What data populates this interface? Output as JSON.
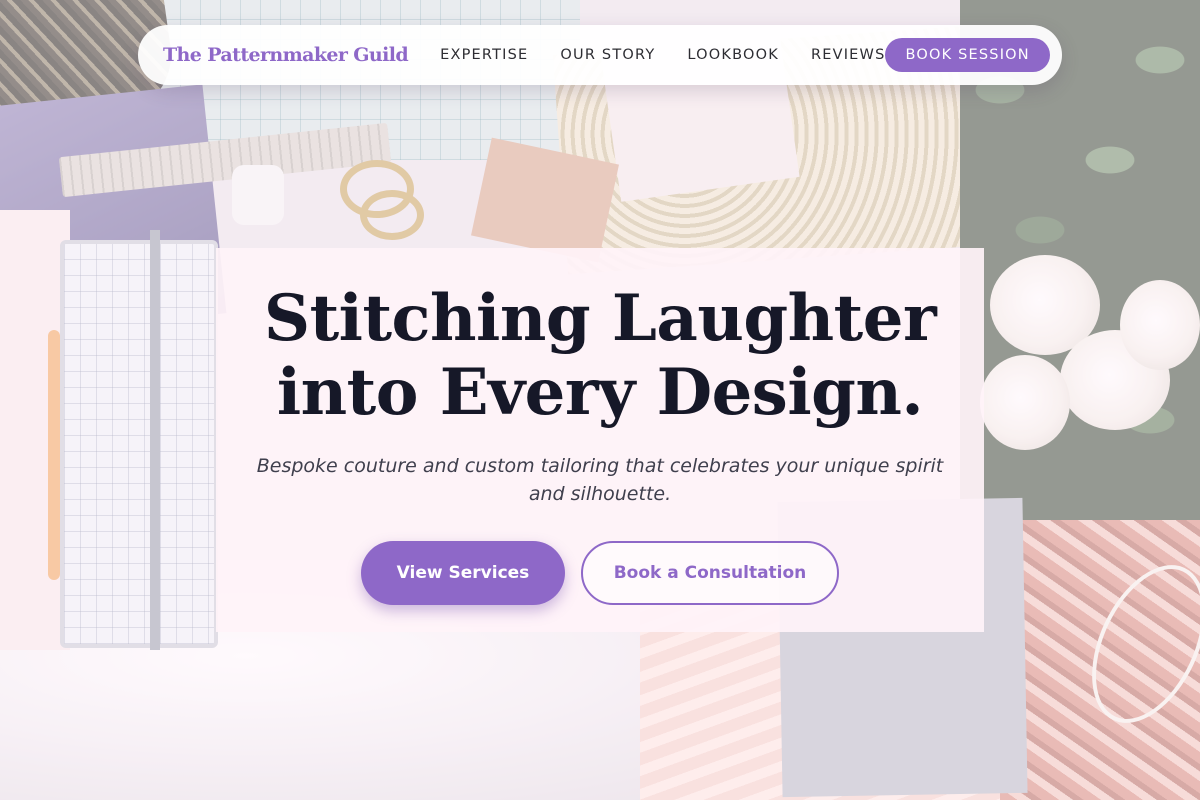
{
  "colors": {
    "accent": "#8e68c8",
    "heading": "#161828",
    "body_text": "#3f3f4d",
    "nav_text": "#2d2d33",
    "hero_panel": "#fff3f8"
  },
  "background": {
    "description_icon": "craft-table-photo"
  },
  "nav": {
    "brand": "The Patternmaker Guild",
    "links": [
      {
        "label": "EXPERTISE"
      },
      {
        "label": "OUR STORY"
      },
      {
        "label": "LOOKBOOK"
      },
      {
        "label": "REVIEWS"
      }
    ],
    "cta_label": "BOOK SESSION"
  },
  "hero": {
    "title_line1": "Stitching Laughter",
    "title_line2": "into Every Design.",
    "subtitle": "Bespoke couture and custom tailoring that celebrates your unique spirit and silhouette.",
    "primary_button": "View Services",
    "secondary_button": "Book a Consultation"
  }
}
